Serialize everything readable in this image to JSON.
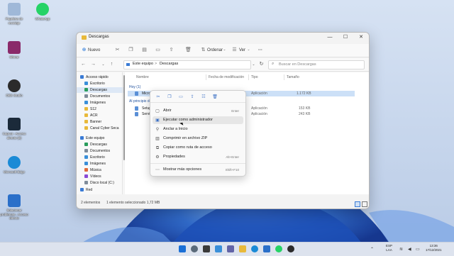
{
  "desktop": {
    "icons": [
      {
        "label": "Papelera de reciclaje",
        "color": "#9fb8d8"
      },
      {
        "label": "WhatsApp",
        "color": "#25d366"
      },
      {
        "label": "Winrar",
        "color": "#8a2a6a"
      },
      {
        "label": "OBS Studio",
        "color": "#2b2b2b"
      },
      {
        "label": "Capcut - Acceso directo (2)",
        "color": "#1b2a3a"
      },
      {
        "label": "Microsoft Edge",
        "color": "#1a8ad6"
      },
      {
        "label": "Solucionar problemas - Acceso directo",
        "color": "#2a6fc9"
      }
    ]
  },
  "window": {
    "title": "Descargas",
    "controls": {
      "minimize": "—",
      "maximize": "☐",
      "close": "✕"
    }
  },
  "toolbar": {
    "new_label": "Nuevo",
    "sort_label": "Ordenar",
    "view_label": "Ver",
    "more_label": "···"
  },
  "address": {
    "segments": [
      "Este equipo",
      ">",
      "Descargas"
    ],
    "search_placeholder": "Buscar en Descargas"
  },
  "nav": {
    "items": [
      {
        "label": "Acceso rápido",
        "color": "#3a7bd5",
        "indent": 0,
        "selected": false
      },
      {
        "label": "Escritorio",
        "color": "#3a8fd9",
        "indent": 1,
        "selected": false
      },
      {
        "label": "Descargas",
        "color": "#2a9d5c",
        "indent": 1,
        "selected": true
      },
      {
        "label": "Documentos",
        "color": "#7f8c9a",
        "indent": 1,
        "selected": false
      },
      {
        "label": "Imágenes",
        "color": "#3a8fd9",
        "indent": 1,
        "selected": false
      },
      {
        "label": "S12",
        "color": "#e8b93a",
        "indent": 1,
        "selected": false
      },
      {
        "label": "ACR",
        "color": "#e8b93a",
        "indent": 1,
        "selected": false
      },
      {
        "label": "Banner",
        "color": "#e8b93a",
        "indent": 1,
        "selected": false
      },
      {
        "label": "Canal Cyber Seca",
        "color": "#e8b93a",
        "indent": 1,
        "selected": false
      },
      {
        "label": "Este equipo",
        "color": "#3a7bd5",
        "indent": 0,
        "selected": false
      },
      {
        "label": "Descargas",
        "color": "#2a9d5c",
        "indent": 1,
        "selected": false
      },
      {
        "label": "Documentos",
        "color": "#7f8c9a",
        "indent": 1,
        "selected": false
      },
      {
        "label": "Escritorio",
        "color": "#3a8fd9",
        "indent": 1,
        "selected": false
      },
      {
        "label": "Imágenes",
        "color": "#3a8fd9",
        "indent": 1,
        "selected": false
      },
      {
        "label": "Música",
        "color": "#e06a3a",
        "indent": 1,
        "selected": false
      },
      {
        "label": "Vídeos",
        "color": "#8a4ad6",
        "indent": 1,
        "selected": false
      },
      {
        "label": "Disco local (C:)",
        "color": "#7f8c9a",
        "indent": 1,
        "selected": false
      },
      {
        "label": "Red",
        "color": "#3a7bd5",
        "indent": 0,
        "selected": false
      }
    ]
  },
  "content": {
    "columns": [
      "Nombre",
      "Fecha de modificación",
      "Tipo",
      "Tamaño"
    ],
    "groups": [
      {
        "label": "Hoy (1)",
        "rows": [
          {
            "name": "Microsoft...",
            "type": "Aplicación",
            "size": "1.172 KB",
            "selected": true
          }
        ]
      },
      {
        "label": "Al principio de...",
        "rows": [
          {
            "name": "Setup...",
            "type": "Aplicación",
            "size": "153 KB",
            "selected": false
          },
          {
            "name": "Servi...",
            "type": "Aplicación",
            "size": "243 KB",
            "selected": false
          }
        ]
      }
    ]
  },
  "status": {
    "count": "2 elementos",
    "selection": "1 elemento seleccionado 1,72 MB"
  },
  "context_menu": {
    "icon_actions": [
      "cut-icon",
      "copy-icon",
      "rename-icon",
      "share-icon",
      "properties-icon",
      "delete-icon"
    ],
    "items": [
      {
        "label": "Abrir",
        "shortcut": "Enter"
      },
      {
        "label": "Ejecutar como administrador",
        "shortcut": ""
      },
      {
        "label": "Anclar a Inicio",
        "shortcut": ""
      },
      {
        "label": "Comprimir en archivo ZIP",
        "shortcut": ""
      },
      {
        "label": "Copiar como ruta de acceso",
        "shortcut": ""
      },
      {
        "label": "Propiedades",
        "shortcut": "Alt+Enter"
      },
      {
        "label": "Mostrar más opciones",
        "shortcut": "Shift+F10"
      }
    ]
  },
  "taskbar": {
    "apps": [
      {
        "name": "start-icon",
        "color": "#1a6fd6"
      },
      {
        "name": "search-icon",
        "color": "#5a6a7a"
      },
      {
        "name": "taskview-icon",
        "color": "#3a3a3a"
      },
      {
        "name": "widgets-icon",
        "color": "#3a8fd9"
      },
      {
        "name": "chat-icon",
        "color": "#6264a7"
      },
      {
        "name": "file-explorer-icon",
        "color": "#e8b93a"
      },
      {
        "name": "edge-icon",
        "color": "#1a8ad6"
      },
      {
        "name": "store-icon",
        "color": "#2a6fc9"
      },
      {
        "name": "whatsapp-icon",
        "color": "#25d366"
      },
      {
        "name": "obs-icon",
        "color": "#2b2b2b"
      }
    ],
    "language": "ESP",
    "language_sub": "LAA",
    "time": "13:36",
    "date": "17/12/2021"
  }
}
